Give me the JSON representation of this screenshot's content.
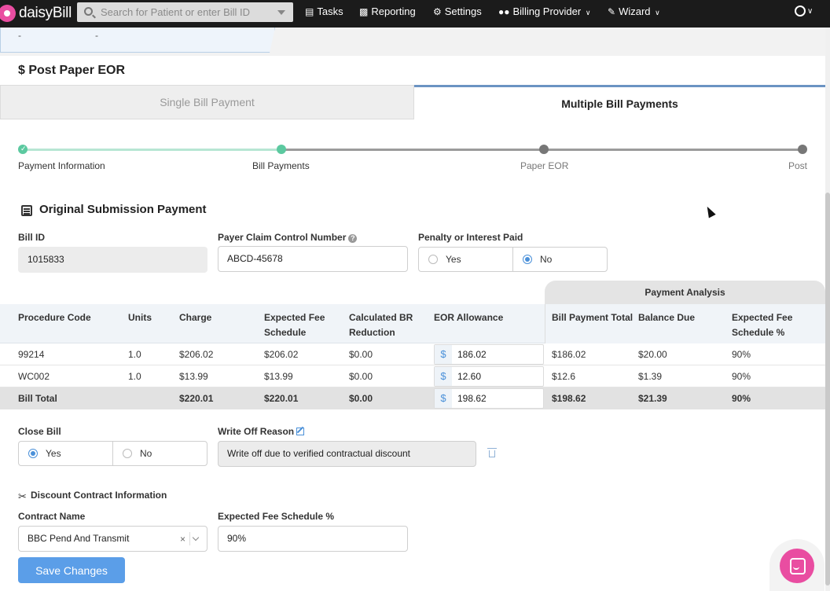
{
  "app": {
    "brand": "daisyBill",
    "search_placeholder": "Search for Patient or enter Bill ID"
  },
  "nav": {
    "tasks": "Tasks",
    "reporting": "Reporting",
    "settings": "Settings",
    "billing_provider": "Billing Provider",
    "wizard": "Wizard"
  },
  "strip": {
    "dash1": "-",
    "dash2": "-"
  },
  "page_title": "$ Post Paper EOR",
  "tabs": {
    "single": "Single Bill Payment",
    "multiple": "Multiple Bill Payments"
  },
  "stepper": {
    "steps": [
      "Payment Information",
      "Bill Payments",
      "Paper EOR",
      "Post"
    ],
    "colors": {
      "done": "#5cc9a0",
      "pending": "#777777",
      "line_done": "#b7e6d3",
      "line_pending": "#9b9b9b"
    }
  },
  "section": {
    "title": "Original Submission Payment"
  },
  "fields": {
    "bill_id_label": "Bill ID",
    "bill_id_value": "1015833",
    "pccn_label": "Payer Claim Control Number",
    "pccn_value": "ABCD-45678",
    "penalty_label": "Penalty or Interest Paid",
    "penalty_yes": "Yes",
    "penalty_no": "No",
    "penalty_selected": "No"
  },
  "table": {
    "payment_analysis": "Payment Analysis",
    "headers": {
      "procedure_code": "Procedure Code",
      "units": "Units",
      "charge": "Charge",
      "expected_fee": "Expected Fee Schedule",
      "br_reduction": "Calculated BR Reduction",
      "eor_allowance": "EOR Allowance",
      "bill_payment_total": "Bill Payment Total",
      "balance_due": "Balance Due",
      "expected_fee_pct": "Expected Fee Schedule %"
    },
    "currency": "$",
    "rows": [
      {
        "code": "99214",
        "units": "1.0",
        "charge": "$206.02",
        "expected": "$206.02",
        "br": "$0.00",
        "eor": "186.02",
        "payment_total": "$186.02",
        "balance": "$20.00",
        "pct": "90%"
      },
      {
        "code": "WC002",
        "units": "1.0",
        "charge": "$13.99",
        "expected": "$13.99",
        "br": "$0.00",
        "eor": "12.60",
        "payment_total": "$12.6",
        "balance": "$1.39",
        "pct": "90%"
      }
    ],
    "total": {
      "label": "Bill Total",
      "charge": "$220.01",
      "expected": "$220.01",
      "br": "$0.00",
      "eor": "198.62",
      "payment_total": "$198.62",
      "balance": "$21.39",
      "pct": "90%"
    }
  },
  "close_bill": {
    "label": "Close Bill",
    "yes": "Yes",
    "no": "No",
    "selected": "Yes",
    "write_off_label": "Write Off Reason",
    "write_off_value": "Write off due to verified contractual discount"
  },
  "discount": {
    "title": "Discount Contract Information",
    "contract_name_label": "Contract Name",
    "contract_name_value": "BBC Pend And Transmit",
    "clear": "×",
    "expected_pct_label": "Expected Fee Schedule %",
    "expected_pct_value": "90%"
  },
  "actions": {
    "save": "Save Changes"
  }
}
